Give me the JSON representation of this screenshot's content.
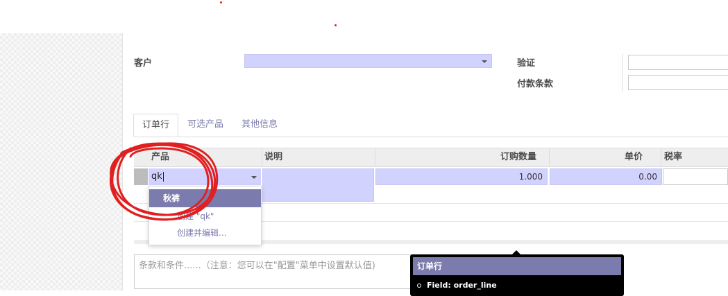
{
  "form": {
    "customer_label": "客户",
    "customer_value": "",
    "validity_label": "验证",
    "validity_value": "",
    "payment_terms_label": "付款条款",
    "payment_terms_value": ""
  },
  "tabs": [
    {
      "label": "订单行",
      "active": true
    },
    {
      "label": "可选产品",
      "active": false
    },
    {
      "label": "其他信息",
      "active": false
    }
  ],
  "table": {
    "headers": {
      "product": "产品",
      "description": "说明",
      "quantity": "订购数量",
      "unit_price": "单价",
      "tax": "税率"
    },
    "row": {
      "product_input": "qk",
      "description": "",
      "quantity": "1.000",
      "unit_price": "0.00",
      "tax": ""
    }
  },
  "dropdown": {
    "items": [
      {
        "label": "秋裤",
        "selected": true
      },
      {
        "label": "创建 \"qk\"",
        "selected": false
      },
      {
        "label": "创建并编辑...",
        "selected": false
      }
    ]
  },
  "terms": {
    "placeholder": "条款和条件......（注意：您可以在\"配置\"菜单中设置默认值)"
  },
  "tooltip": {
    "title": "订单行",
    "field_line": "Field: order_line"
  },
  "colors": {
    "accent": "#7c7bad",
    "required_bg": "#d2d2ff",
    "annotation": "#e02020"
  }
}
